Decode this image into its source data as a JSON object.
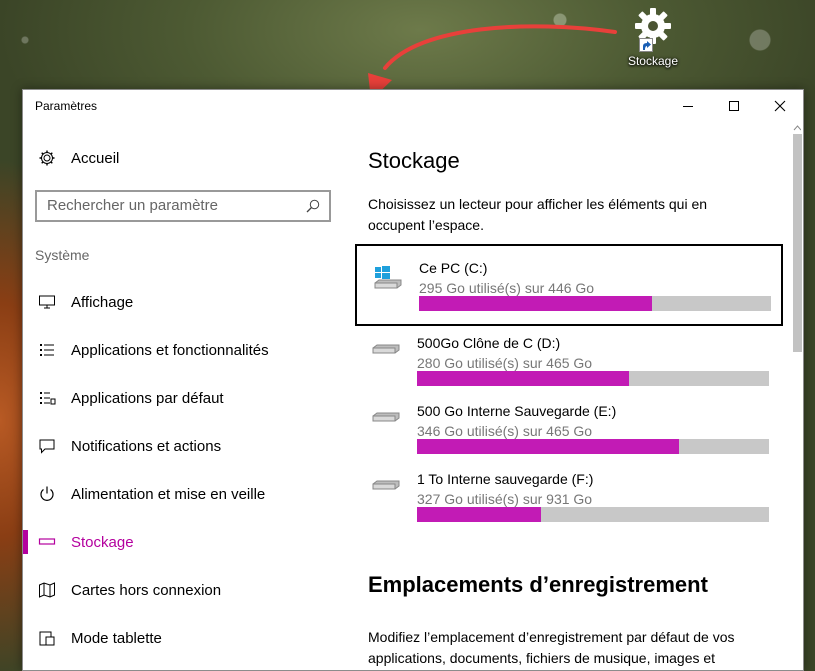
{
  "desktop": {
    "shortcut_label": "Stockage"
  },
  "window": {
    "title": "Paramètres"
  },
  "sidebar": {
    "home_label": "Accueil",
    "search_placeholder": "Rechercher un paramètre",
    "section_label": "Système",
    "items": [
      {
        "label": "Affichage",
        "icon": "monitor-icon"
      },
      {
        "label": "Applications et fonctionnalités",
        "icon": "app-list-icon"
      },
      {
        "label": "Applications par défaut",
        "icon": "default-apps-icon"
      },
      {
        "label": "Notifications et actions",
        "icon": "notification-icon"
      },
      {
        "label": "Alimentation et mise en veille",
        "icon": "power-icon"
      },
      {
        "label": "Stockage",
        "icon": "storage-icon",
        "active": true
      },
      {
        "label": "Cartes hors connexion",
        "icon": "map-icon"
      },
      {
        "label": "Mode tablette",
        "icon": "tablet-icon"
      }
    ]
  },
  "main": {
    "title": "Stockage",
    "description": "Choisissez un lecteur pour afficher les éléments qui en occupent l’espace.",
    "drives": [
      {
        "name": "Ce PC (C:)",
        "usage": "295 Go utilisé(s) sur 446 Go",
        "used_fraction": 0.661,
        "icon": "windows-drive-icon"
      },
      {
        "name": "500Go Clône de C (D:)",
        "usage": "280 Go utilisé(s) sur 465 Go",
        "used_fraction": 0.602,
        "icon": "drive-icon"
      },
      {
        "name": "500 Go Interne Sauvegarde (E:)",
        "usage": "346 Go utilisé(s) sur 465 Go",
        "used_fraction": 0.744,
        "icon": "drive-icon"
      },
      {
        "name": "1 To Interne sauvegarde (F:)",
        "usage": "327 Go utilisé(s) sur 931 Go",
        "used_fraction": 0.351,
        "icon": "drive-icon"
      }
    ],
    "section_title": "Emplacements d’enregistrement",
    "section_description": "Modifiez l’emplacement d’enregistrement par défaut de vos applications, documents, fichiers de musique, images et"
  },
  "colors": {
    "accent": "#b4009e",
    "bar_fill": "#c21bb5",
    "bar_track": "#c8c8c8",
    "arrow": "#e8403a"
  }
}
